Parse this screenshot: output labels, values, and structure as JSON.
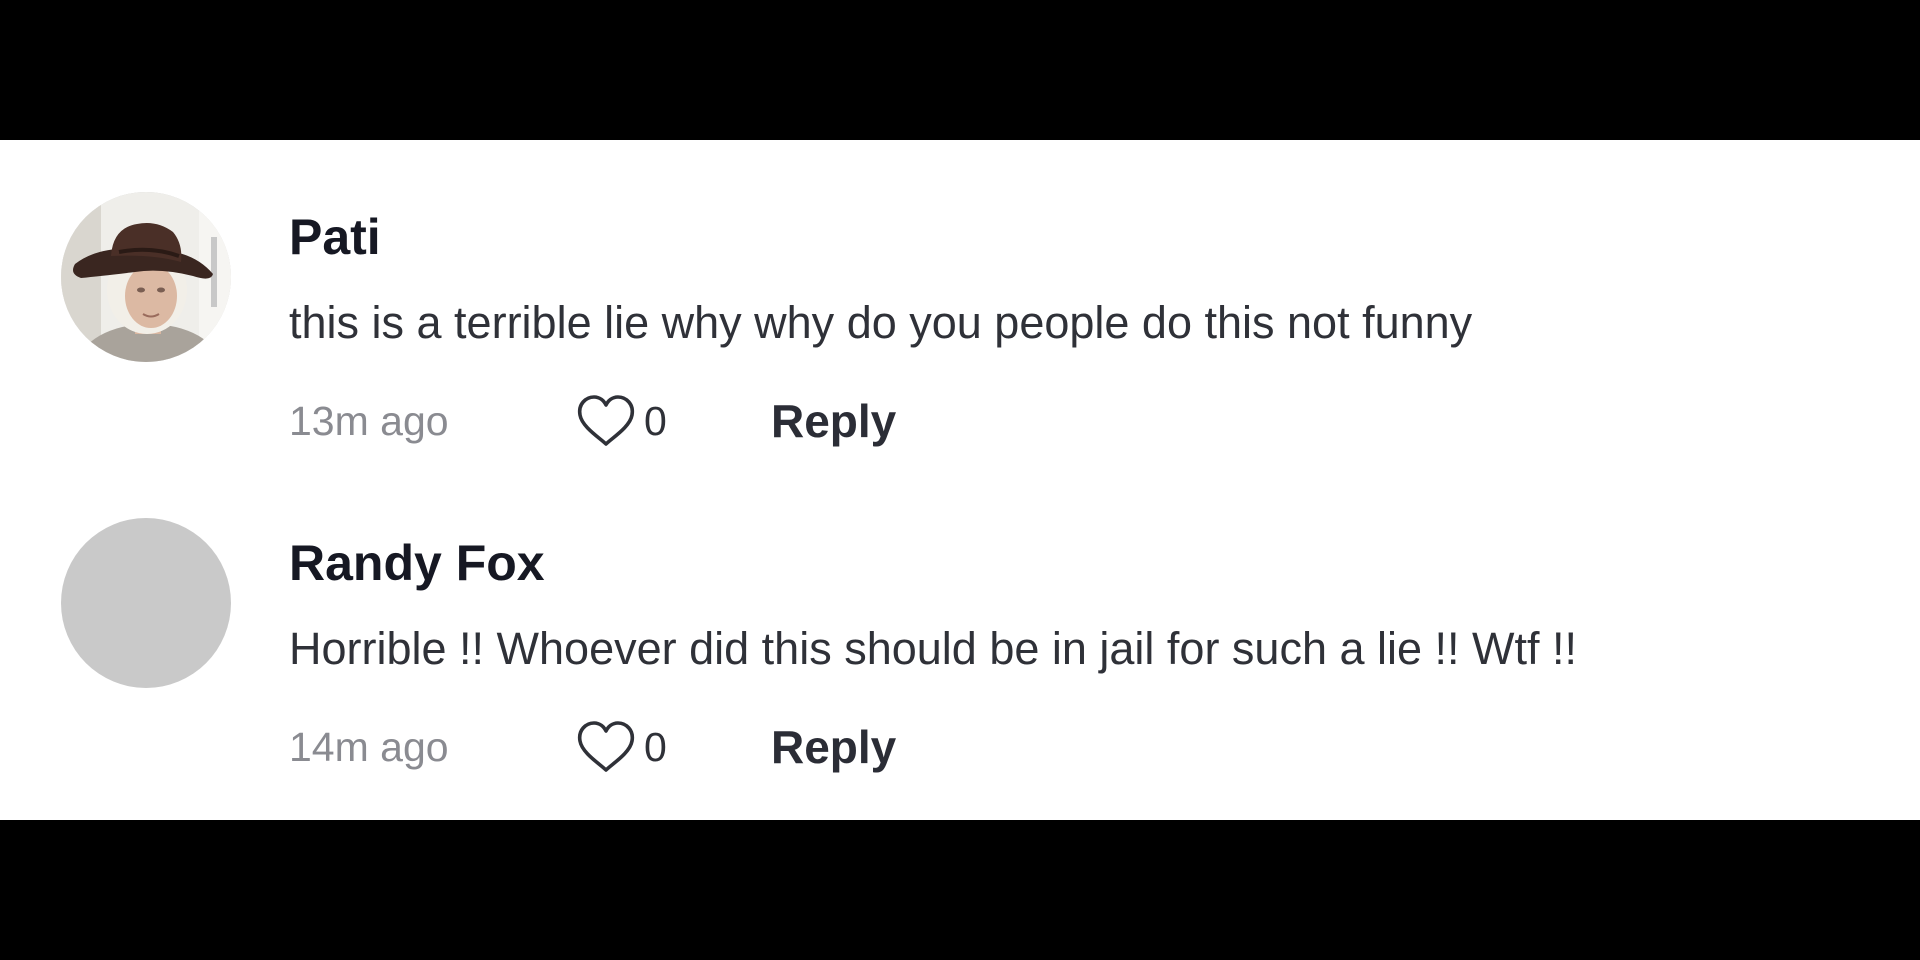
{
  "comments": [
    {
      "username": "Pati",
      "text": "this is a terrible lie why why do you people do this not funny",
      "time": "13m ago",
      "likes": "0",
      "reply_label": "Reply",
      "avatar_type": "photo"
    },
    {
      "username": "Randy Fox",
      "text": "Horrible !! Whoever did this should be in jail for such a lie !! Wtf !!",
      "time": "14m ago",
      "likes": "0",
      "reply_label": "Reply",
      "avatar_type": "placeholder"
    }
  ],
  "icons": {
    "like": "heart-outline-icon"
  },
  "colors": {
    "background": "#ffffff",
    "letterbox": "#000000",
    "username": "#161823",
    "text": "#2f3138",
    "timestamp": "#8a8b91",
    "placeholder_avatar": "#c9c9c9"
  }
}
